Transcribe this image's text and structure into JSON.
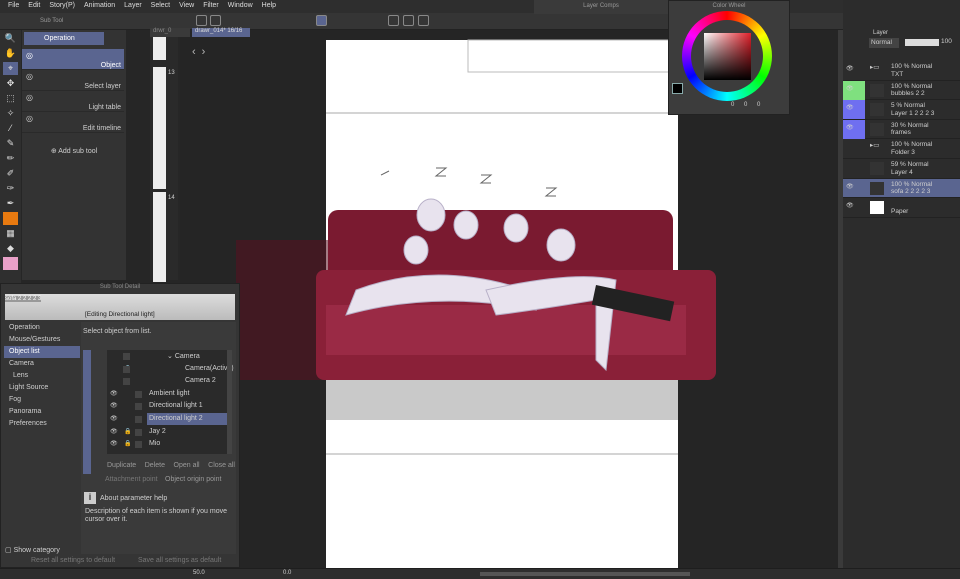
{
  "menu": [
    "File",
    "Edit",
    "Story(P)",
    "Animation",
    "Layer",
    "Select",
    "View",
    "Filter",
    "Window",
    "Help"
  ],
  "tabs": {
    "story_tab": "drwr_0",
    "canvas_tab": "drawr_014* 16/16"
  },
  "subtool": {
    "title": "Sub Tool",
    "group": "Operation",
    "items": [
      "Object",
      "Select layer",
      "Light table",
      "Edit timeline"
    ],
    "add": "Add sub tool"
  },
  "story": {
    "pages": [
      "13",
      "14"
    ]
  },
  "detail": {
    "title": "Sub Tool Detail",
    "layer_name": "sofa 2 2 2 2 3",
    "editing": "[Editing Directional light]",
    "categories": [
      "Operation",
      "Mouse/Gestures",
      "Object list",
      "Camera",
      "Lens",
      "Light Source",
      "Fog",
      "Panorama",
      "Preferences"
    ],
    "selected_category": "Object list",
    "prompt": "Select object from list.",
    "objects": [
      {
        "name": "Camera",
        "indent": 2,
        "eye": false,
        "lock": false,
        "expander": true
      },
      {
        "name": "Camera(Active)",
        "indent": 3,
        "eye": false,
        "lock": true
      },
      {
        "name": "Camera 2",
        "indent": 3,
        "eye": false,
        "lock": false
      },
      {
        "name": "Ambient light",
        "indent": 1,
        "eye": true,
        "lock": false
      },
      {
        "name": "Directional light 1",
        "indent": 1,
        "eye": true,
        "lock": false
      },
      {
        "name": "Directional light 2",
        "indent": 1,
        "eye": true,
        "lock": false,
        "selected": true
      },
      {
        "name": "Jay 2",
        "indent": 1,
        "eye": true,
        "lock": true
      },
      {
        "name": "Mio",
        "indent": 1,
        "eye": true,
        "lock": true
      }
    ],
    "buttons": [
      "Duplicate",
      "Delete",
      "Open all",
      "Close all"
    ],
    "attachment_label": "Attachment point",
    "attachment_value": "Object origin point",
    "help_title": "About parameter help",
    "help_text": "Description of each item is shown if you move cursor over it.",
    "show_category": "Show category",
    "reset": "Reset all settings to default",
    "save": "Save all settings as default"
  },
  "layer_comps": {
    "title": "Layer Comps"
  },
  "color_wheel": {
    "title": "Color Wheel",
    "main_color": "#000000",
    "hue_color": "#e0202a",
    "values": [
      "0",
      "0",
      "0"
    ]
  },
  "layers": {
    "tab": "Layer",
    "blend": "Normal",
    "opacity": "100",
    "rows": [
      {
        "pct": "100 %",
        "mode": "Normal",
        "name": "TXT",
        "folder": true,
        "eye": true,
        "color": ""
      },
      {
        "pct": "100 %",
        "mode": "Normal",
        "name": "bubbles 2 2",
        "eye": true,
        "color": "#7fe07f"
      },
      {
        "pct": "5 %",
        "mode": "Normal",
        "name": "Layer 1 2 2 2 3",
        "eye": true,
        "color": "#6f6ff0"
      },
      {
        "pct": "30 %",
        "mode": "Normal",
        "name": "frames",
        "eye": true,
        "color": "#6f6ff0"
      },
      {
        "pct": "100 %",
        "mode": "Normal",
        "name": "Folder 3",
        "folder": true,
        "eye": false,
        "color": ""
      },
      {
        "pct": "59 %",
        "mode": "Normal",
        "name": "Layer 4",
        "eye": false,
        "color": ""
      },
      {
        "pct": "100 %",
        "mode": "Normal",
        "name": "sofa 2 2 2 2 3",
        "eye": true,
        "color": "",
        "selected": true
      },
      {
        "pct": "",
        "mode": "",
        "name": "Paper",
        "eye": true,
        "color": ""
      }
    ]
  },
  "status": {
    "zoom": "50.0",
    "angle": "0.0"
  }
}
